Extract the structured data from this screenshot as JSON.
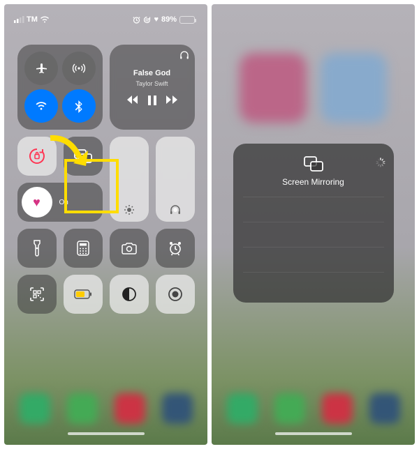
{
  "status": {
    "carrier": "TM",
    "signal_bars": 2,
    "wifi": true,
    "battery_pct": 89,
    "battery_color": "#ffcc00",
    "indicators": [
      "alarm-icon",
      "lock-rotation-icon",
      "heart-icon"
    ]
  },
  "connectivity": {
    "airplane": {
      "active": false
    },
    "cellular": {
      "active": false
    },
    "wifi": {
      "active": true
    },
    "bluetooth": {
      "active": true
    }
  },
  "media": {
    "title": "False God",
    "artist": "Taylor Swift",
    "output_icon": "headphones-icon"
  },
  "focus": {
    "icon": "heart-icon",
    "status": "On"
  },
  "tiles": {
    "rotation_lock": true,
    "screen_mirroring": "screen-mirroring-icon",
    "brightness": "brightness-icon",
    "volume": "headphones-icon",
    "row_icons": [
      "flashlight-icon",
      "calculator-icon",
      "camera-icon",
      "clock-icon"
    ],
    "row2_icons": [
      "qr-scan-icon",
      "low-power-icon",
      "dark-mode-icon",
      "screen-record-icon"
    ]
  },
  "mirror_panel": {
    "title": "Screen Mirroring",
    "loading": true
  },
  "colors": {
    "active_blue": "#007aff",
    "highlight": "#ffdd00"
  }
}
